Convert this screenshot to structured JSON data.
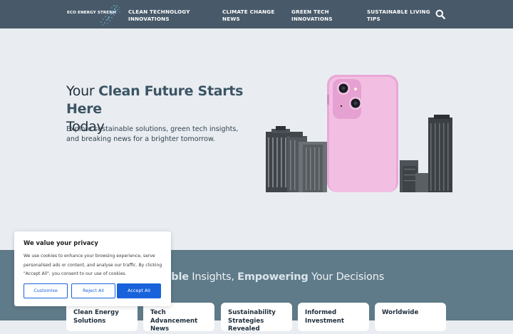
{
  "header": {
    "logo_text": "ECO ENERGY STREAM",
    "nav": [
      {
        "line1": "CLEAN TECHNOLOGY",
        "line2": "INNOVATIONS"
      },
      {
        "line1": "CLIMATE CHANGE",
        "line2": "NEWS"
      },
      {
        "line1": "GREEN TECH",
        "line2": "INNOVATIONS"
      },
      {
        "line1": "SUSTAINABLE LIVING",
        "line2": "TIPS"
      }
    ],
    "search_icon": "search-icon"
  },
  "hero": {
    "title_prefix": "Your ",
    "title_accent": "Clean Future Starts Here",
    "title_suffix": "Today",
    "subtitle": "Explore sustainable solutions, green tech insights, and breaking news for a brighter tomorrow.",
    "image": "smartphone-with-skyscrapers"
  },
  "band": {
    "heading_parts": [
      {
        "text": "ustainable",
        "bold": true
      },
      {
        "text": " Insights, ",
        "bold": false
      },
      {
        "text": "Empowering",
        "bold": true
      },
      {
        "text": " Your Decisions",
        "bold": false
      }
    ],
    "cards": [
      {
        "line1": "Clean Energy",
        "line2": "Solutions"
      },
      {
        "line1": "Tech Advancement",
        "line2": "News"
      },
      {
        "line1": "Sustainability",
        "line2": "Strategies Revealed"
      },
      {
        "line1": "Informed",
        "line2": "Investment"
      },
      {
        "line1": "Worldwide",
        "line2": ""
      }
    ]
  },
  "cookie": {
    "title": "We value your privacy",
    "text": "We use cookies to enhance your browsing experience, serve personalised ads or content, and analyse our traffic. By clicking \"Accept All\", you consent to our use of cookies.",
    "buttons": {
      "customise": "Customise",
      "reject": "Reject All",
      "accept": "Accept All"
    },
    "accent_color": "#1863dc"
  },
  "colors": {
    "header_bg": "#485a69",
    "hero_bg": "#e9edf1",
    "band_bg": "#5f7a88"
  }
}
